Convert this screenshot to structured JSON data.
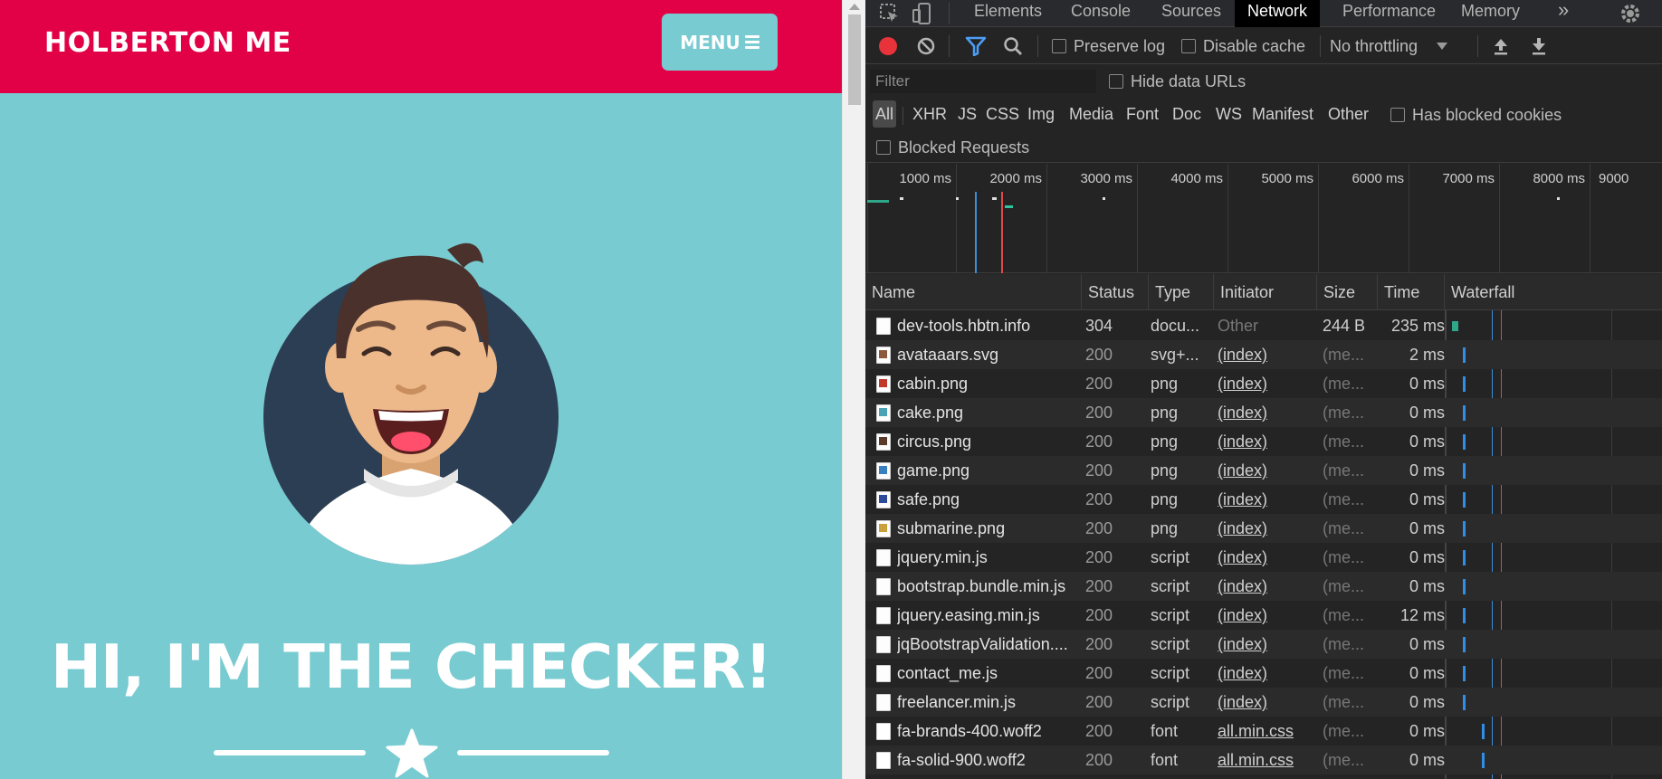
{
  "site": {
    "brand": "HOLBERTON ME",
    "menu_label": "MENU",
    "hero_title": "HI, I'M THE CHECKER!",
    "colors": {
      "nav": "#e20046",
      "page": "#78cbd1"
    }
  },
  "devtools": {
    "tabs": [
      "Elements",
      "Console",
      "Sources",
      "Network",
      "Performance",
      "Memory"
    ],
    "active_tab": "Network",
    "more_tabs": "»",
    "toolbar": {
      "preserve_log": "Preserve log",
      "disable_cache": "Disable cache",
      "throttling": "No throttling"
    },
    "filter_placeholder": "Filter",
    "hide_data_urls": "Hide data URLs",
    "type_filters": [
      "All",
      "XHR",
      "JS",
      "CSS",
      "Img",
      "Media",
      "Font",
      "Doc",
      "WS",
      "Manifest",
      "Other"
    ],
    "active_type": "All",
    "has_blocked_cookies": "Has blocked cookies",
    "blocked_requests": "Blocked Requests",
    "overview_ticks": [
      "1000 ms",
      "2000 ms",
      "3000 ms",
      "4000 ms",
      "5000 ms",
      "6000 ms",
      "7000 ms",
      "8000 ms",
      "9000"
    ],
    "columns": [
      "Name",
      "Status",
      "Type",
      "Initiator",
      "Size",
      "Time",
      "Waterfall"
    ],
    "rows": [
      {
        "name": "dev-tools.hbtn.info",
        "status": "304",
        "type": "docu...",
        "initiator": "Other",
        "size": "244 B",
        "time": "235 ms",
        "icon": "doc"
      },
      {
        "name": "avataaars.svg",
        "status": "200",
        "type": "svg+...",
        "initiator": "(index)",
        "size": "(me...",
        "time": "2 ms",
        "icon": "img",
        "thumb": "#8b5a3c"
      },
      {
        "name": "cabin.png",
        "status": "200",
        "type": "png",
        "initiator": "(index)",
        "size": "(me...",
        "time": "0 ms",
        "icon": "img",
        "thumb": "#c0392b"
      },
      {
        "name": "cake.png",
        "status": "200",
        "type": "png",
        "initiator": "(index)",
        "size": "(me...",
        "time": "0 ms",
        "icon": "img",
        "thumb": "#4aa3b5"
      },
      {
        "name": "circus.png",
        "status": "200",
        "type": "png",
        "initiator": "(index)",
        "size": "(me...",
        "time": "0 ms",
        "icon": "img",
        "thumb": "#5a3a2a"
      },
      {
        "name": "game.png",
        "status": "200",
        "type": "png",
        "initiator": "(index)",
        "size": "(me...",
        "time": "0 ms",
        "icon": "img",
        "thumb": "#3a7fc0"
      },
      {
        "name": "safe.png",
        "status": "200",
        "type": "png",
        "initiator": "(index)",
        "size": "(me...",
        "time": "0 ms",
        "icon": "img",
        "thumb": "#2d4a9c"
      },
      {
        "name": "submarine.png",
        "status": "200",
        "type": "png",
        "initiator": "(index)",
        "size": "(me...",
        "time": "0 ms",
        "icon": "img",
        "thumb": "#c8a03c"
      },
      {
        "name": "jquery.min.js",
        "status": "200",
        "type": "script",
        "initiator": "(index)",
        "size": "(me...",
        "time": "0 ms",
        "icon": "doc"
      },
      {
        "name": "bootstrap.bundle.min.js",
        "status": "200",
        "type": "script",
        "initiator": "(index)",
        "size": "(me...",
        "time": "0 ms",
        "icon": "doc"
      },
      {
        "name": "jquery.easing.min.js",
        "status": "200",
        "type": "script",
        "initiator": "(index)",
        "size": "(me...",
        "time": "12 ms",
        "icon": "doc"
      },
      {
        "name": "jqBootstrapValidation....",
        "status": "200",
        "type": "script",
        "initiator": "(index)",
        "size": "(me...",
        "time": "0 ms",
        "icon": "doc"
      },
      {
        "name": "contact_me.js",
        "status": "200",
        "type": "script",
        "initiator": "(index)",
        "size": "(me...",
        "time": "0 ms",
        "icon": "doc"
      },
      {
        "name": "freelancer.min.js",
        "status": "200",
        "type": "script",
        "initiator": "(index)",
        "size": "(me...",
        "time": "0 ms",
        "icon": "doc"
      },
      {
        "name": "fa-brands-400.woff2",
        "status": "200",
        "type": "font",
        "initiator": "all.min.css",
        "size": "(me...",
        "time": "0 ms",
        "icon": "font"
      },
      {
        "name": "fa-solid-900.woff2",
        "status": "200",
        "type": "font",
        "initiator": "all.min.css",
        "size": "(me...",
        "time": "0 ms",
        "icon": "font"
      }
    ]
  }
}
